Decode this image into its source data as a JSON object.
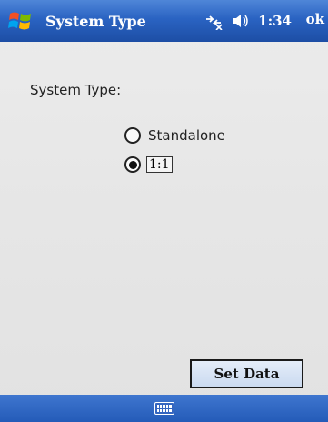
{
  "titlebar": {
    "title": "System Type",
    "time": "1:34",
    "ok_label": "ok",
    "icons": [
      "windows-start-icon",
      "connectivity-icon",
      "volume-icon"
    ]
  },
  "form": {
    "label": "System Type:",
    "options": [
      {
        "label": "Standalone",
        "selected": false
      },
      {
        "label": "1:1",
        "selected": true
      }
    ]
  },
  "actions": {
    "set_data_label": "Set Data"
  },
  "menubar": {
    "icons": [
      "keyboard-icon"
    ]
  },
  "colors": {
    "titlebar": "#2a63c2",
    "background": "#e6e6e6",
    "button": "#cbdaf0"
  }
}
